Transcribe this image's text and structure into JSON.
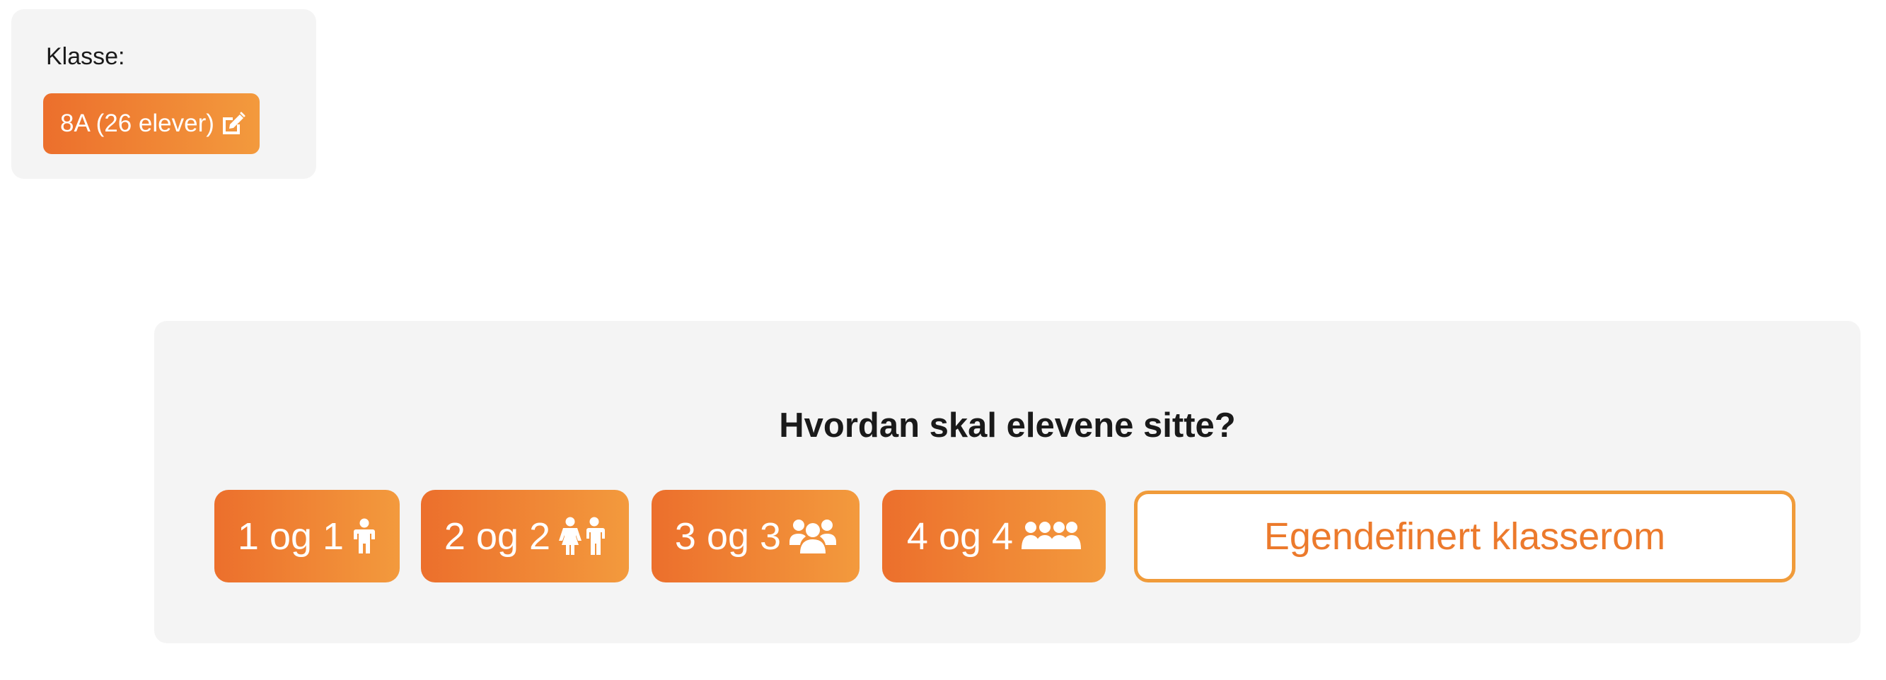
{
  "class_card": {
    "label": "Klasse:",
    "class_button_label": "8A (26 elever)",
    "edit_icon": "edit-icon"
  },
  "seating": {
    "title": "Hvordan skal elevene sitte?",
    "options": [
      {
        "label": "1 og 1",
        "icon": "single-child-icon"
      },
      {
        "label": "2 og 2",
        "icon": "two-children-icon"
      },
      {
        "label": "3 og 3",
        "icon": "three-people-icon"
      },
      {
        "label": "4 og 4",
        "icon": "four-people-icon"
      }
    ],
    "custom_label": "Egendefinert klasserom"
  },
  "colors": {
    "accent_start": "#ec6f2c",
    "accent_end": "#f39a3d",
    "panel_bg": "#f4f4f4"
  }
}
